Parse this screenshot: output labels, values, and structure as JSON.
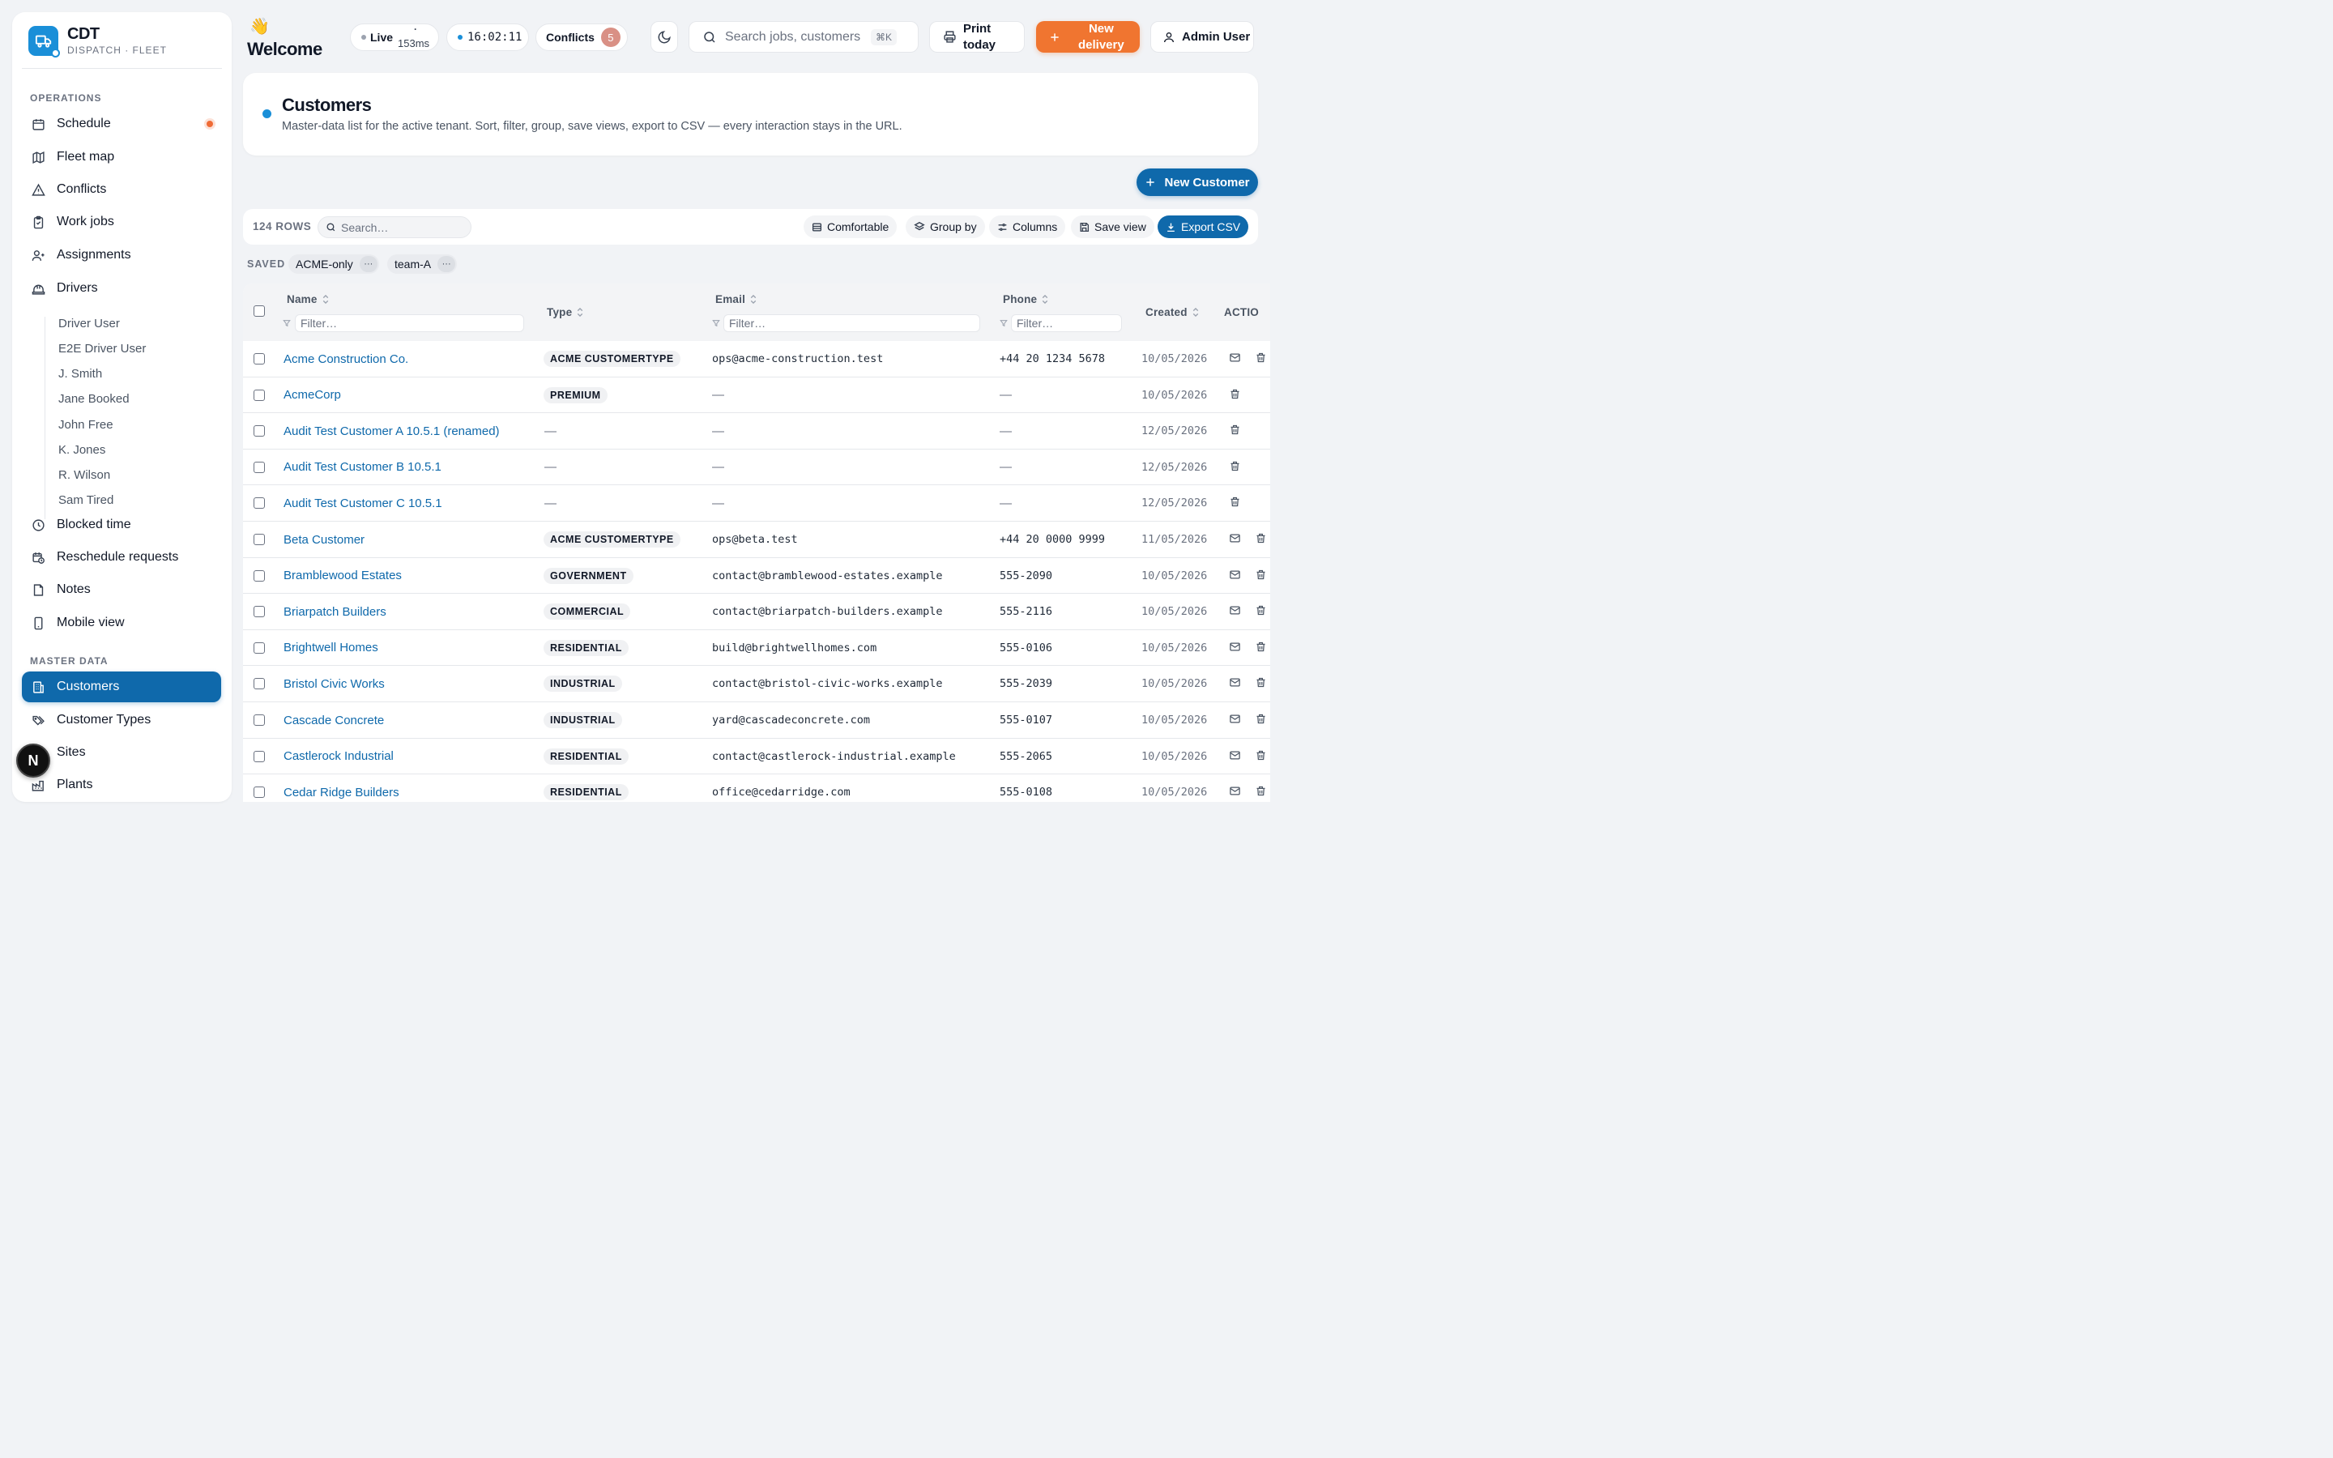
{
  "brand": {
    "title": "CDT",
    "subtitle": "DISPATCH · FLEET"
  },
  "sidebar": {
    "operations_label": "OPERATIONS",
    "master_label": "MASTER DATA",
    "items": [
      {
        "label": "Schedule",
        "icon": "calendar-icon"
      },
      {
        "label": "Fleet map",
        "icon": "map-icon"
      },
      {
        "label": "Conflicts",
        "icon": "alert-triangle-icon"
      },
      {
        "label": "Work jobs",
        "icon": "clipboard-icon"
      },
      {
        "label": "Assignments",
        "icon": "user-assign-icon"
      },
      {
        "label": "Drivers",
        "icon": "hard-hat-icon"
      },
      {
        "label": "Blocked time",
        "icon": "clock-icon"
      },
      {
        "label": "Reschedule requests",
        "icon": "calendar-clock-icon"
      },
      {
        "label": "Notes",
        "icon": "note-icon"
      },
      {
        "label": "Mobile view",
        "icon": "smartphone-icon"
      }
    ],
    "drivers": [
      "Driver User",
      "E2E Driver User",
      "J. Smith",
      "Jane Booked",
      "John Free",
      "K. Jones",
      "R. Wilson",
      "Sam Tired"
    ],
    "master_items": [
      {
        "label": "Customers",
        "icon": "building-icon"
      },
      {
        "label": "Customer Types",
        "icon": "tags-icon"
      },
      {
        "label": "Sites",
        "icon": "map-pin-icon"
      },
      {
        "label": "Plants",
        "icon": "factory-icon"
      }
    ],
    "n_badge": "N"
  },
  "topbar": {
    "welcome": "Welcome",
    "wave": "👋",
    "live_label": "Live",
    "live_latency": "153ms",
    "live_mark": "·",
    "clock": "16:02:11",
    "conflicts_label": "Conflicts",
    "conflicts_count": "5",
    "search_placeholder": "Search jobs, customers…",
    "search_kbd": "⌘K",
    "print_line1": "Print",
    "print_line2": "today",
    "new_delivery_line1": "New",
    "new_delivery_line2": "delivery",
    "user": "Admin User"
  },
  "page": {
    "title": "Customers",
    "description": "Master-data list for the active tenant. Sort, filter, group, save views, export to CSV — every interaction stays in the URL.",
    "new_customer": "New Customer"
  },
  "toolbar": {
    "rows": "124 ROWS",
    "search_placeholder": "Search…",
    "comfortable": "Comfortable",
    "group_by": "Group by",
    "columns": "Columns",
    "save_view": "Save view",
    "export_csv": "Export CSV"
  },
  "saved": {
    "label": "SAVED",
    "views": [
      "ACME-only",
      "team-A"
    ],
    "more": "···"
  },
  "table": {
    "headers": {
      "name": "Name",
      "type": "Type",
      "email": "Email",
      "phone": "Phone",
      "created": "Created",
      "actions": "ACTIO"
    },
    "filter_placeholder": "Filter…",
    "rows": [
      {
        "name": "Acme Construction Co.",
        "type": "ACME CUSTOMERTYPE",
        "email": "ops@acme-construction.test",
        "phone": "+44 20 1234 5678",
        "created": "10/05/2026",
        "actions": [
          "mail",
          "trash"
        ]
      },
      {
        "name": "AcmeCorp",
        "type": "PREMIUM",
        "email": "—",
        "phone": "—",
        "created": "10/05/2026",
        "actions": [
          "trash"
        ]
      },
      {
        "name": "Audit Test Customer A 10.5.1 (renamed)",
        "type": "—",
        "email": "—",
        "phone": "—",
        "created": "12/05/2026",
        "actions": [
          "trash"
        ]
      },
      {
        "name": "Audit Test Customer B 10.5.1",
        "type": "—",
        "email": "—",
        "phone": "—",
        "created": "12/05/2026",
        "actions": [
          "trash"
        ]
      },
      {
        "name": "Audit Test Customer C 10.5.1",
        "type": "—",
        "email": "—",
        "phone": "—",
        "created": "12/05/2026",
        "actions": [
          "trash"
        ]
      },
      {
        "name": "Beta Customer",
        "type": "ACME CUSTOMERTYPE",
        "email": "ops@beta.test",
        "phone": "+44 20 0000 9999",
        "created": "11/05/2026",
        "actions": [
          "mail",
          "trash"
        ]
      },
      {
        "name": "Bramblewood Estates",
        "type": "GOVERNMENT",
        "email": "contact@bramblewood-estates.example",
        "phone": "555-2090",
        "created": "10/05/2026",
        "actions": [
          "mail",
          "trash"
        ]
      },
      {
        "name": "Briarpatch Builders",
        "type": "COMMERCIAL",
        "email": "contact@briarpatch-builders.example",
        "phone": "555-2116",
        "created": "10/05/2026",
        "actions": [
          "mail",
          "trash"
        ]
      },
      {
        "name": "Brightwell Homes",
        "type": "RESIDENTIAL",
        "email": "build@brightwellhomes.com",
        "phone": "555-0106",
        "created": "10/05/2026",
        "actions": [
          "mail",
          "trash"
        ]
      },
      {
        "name": "Bristol Civic Works",
        "type": "INDUSTRIAL",
        "email": "contact@bristol-civic-works.example",
        "phone": "555-2039",
        "created": "10/05/2026",
        "actions": [
          "mail",
          "trash"
        ]
      },
      {
        "name": "Cascade Concrete",
        "type": "INDUSTRIAL",
        "email": "yard@cascadeconcrete.com",
        "phone": "555-0107",
        "created": "10/05/2026",
        "actions": [
          "mail",
          "trash"
        ]
      },
      {
        "name": "Castlerock Industrial",
        "type": "RESIDENTIAL",
        "email": "contact@castlerock-industrial.example",
        "phone": "555-2065",
        "created": "10/05/2026",
        "actions": [
          "mail",
          "trash"
        ]
      },
      {
        "name": "Cedar Ridge Builders",
        "type": "RESIDENTIAL",
        "email": "office@cedarridge.com",
        "phone": "555-0108",
        "created": "10/05/2026",
        "actions": [
          "mail",
          "trash"
        ]
      }
    ]
  },
  "colors": {
    "accent": "#0f69ab",
    "brand": "#1a8fd8",
    "orange": "#f07530"
  }
}
